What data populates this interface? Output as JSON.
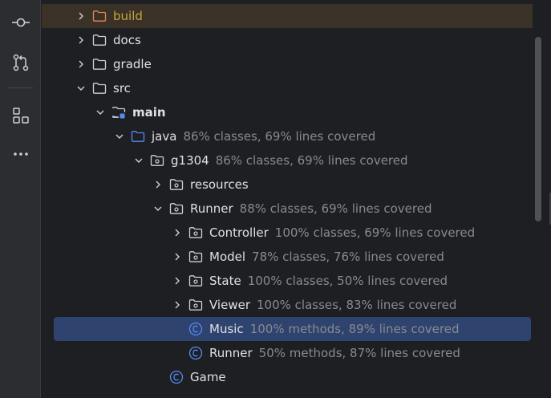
{
  "toolbar": {
    "buttons": [
      {
        "icon": "commit-icon"
      },
      {
        "icon": "pull-request-icon"
      },
      {
        "icon": "structure-icon"
      },
      {
        "icon": "more-icon"
      }
    ]
  },
  "tree": {
    "rows": [
      {
        "name": "build",
        "coverage": "",
        "depth": 0,
        "expanded": false,
        "icon": "folder-excluded"
      },
      {
        "name": "docs",
        "coverage": "",
        "depth": 0,
        "expanded": false,
        "icon": "folder"
      },
      {
        "name": "gradle",
        "coverage": "",
        "depth": 0,
        "expanded": false,
        "icon": "folder"
      },
      {
        "name": "src",
        "coverage": "",
        "depth": 0,
        "expanded": true,
        "icon": "folder"
      },
      {
        "name": "main",
        "coverage": "",
        "depth": 1,
        "expanded": true,
        "icon": "module-folder"
      },
      {
        "name": "java",
        "coverage": "86% classes, 69% lines covered",
        "depth": 2,
        "expanded": true,
        "icon": "source-folder"
      },
      {
        "name": "g1304",
        "coverage": "86% classes, 69% lines covered",
        "depth": 3,
        "expanded": true,
        "icon": "package"
      },
      {
        "name": "resources",
        "coverage": "",
        "depth": 4,
        "expanded": false,
        "icon": "package"
      },
      {
        "name": "Runner",
        "coverage": "88% classes, 69% lines covered",
        "depth": 4,
        "expanded": true,
        "icon": "package"
      },
      {
        "name": "Controller",
        "coverage": "100% classes, 69% lines covered",
        "depth": 5,
        "expanded": false,
        "icon": "package"
      },
      {
        "name": "Model",
        "coverage": "78% classes, 76% lines covered",
        "depth": 5,
        "expanded": false,
        "icon": "package"
      },
      {
        "name": "State",
        "coverage": "100% classes, 50% lines covered",
        "depth": 5,
        "expanded": false,
        "icon": "package"
      },
      {
        "name": "Viewer",
        "coverage": "100% classes, 83% lines covered",
        "depth": 5,
        "expanded": false,
        "icon": "package"
      },
      {
        "name": "Music",
        "coverage": "100% methods, 89% lines covered",
        "depth": 5,
        "expanded": null,
        "icon": "class",
        "selected": true
      },
      {
        "name": "Runner",
        "coverage": "50% methods, 87% lines covered",
        "depth": 5,
        "expanded": null,
        "icon": "class"
      },
      {
        "name": "Game",
        "coverage": "",
        "depth": 4,
        "expanded": null,
        "icon": "class"
      }
    ]
  },
  "colors": {
    "selection": "#2e436e",
    "build_row": "#3a3226",
    "build_text": "#c9a441",
    "class_icon": "#548af7",
    "coverage_text": "#878a91"
  }
}
